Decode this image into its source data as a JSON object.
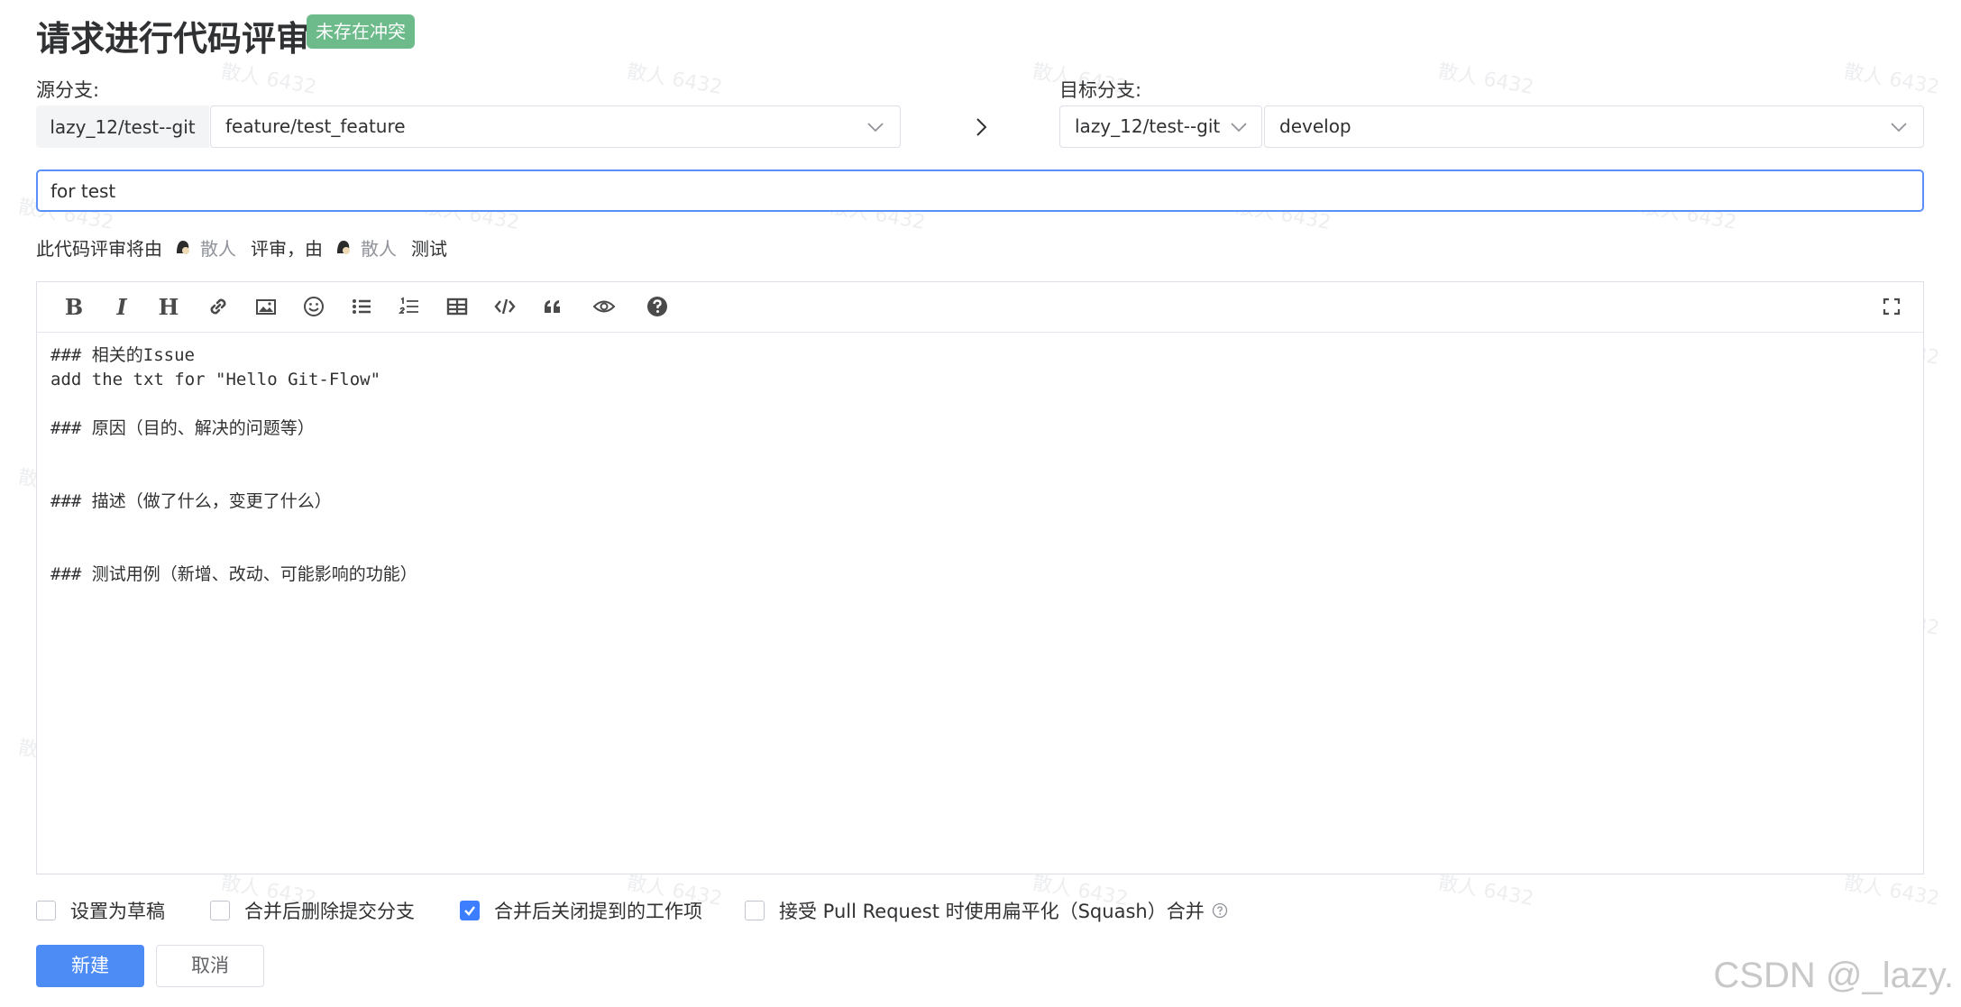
{
  "header": {
    "title": "请求进行代码评审",
    "badge": "未存在冲突"
  },
  "source": {
    "label": "源分支:",
    "repo": "lazy_12/test--git",
    "branch": "feature/test_feature"
  },
  "target": {
    "label": "目标分支:",
    "repo": "lazy_12/test--git",
    "branch": "develop"
  },
  "pr_title": {
    "value": "for test"
  },
  "reviewers": {
    "prefix": "此代码评审将由",
    "reviewer": "散人",
    "middle": "评审，由",
    "tester": "散人",
    "suffix": "测试"
  },
  "toolbar": {
    "items": [
      "bold-icon",
      "italic-icon",
      "heading-icon",
      "link-icon",
      "image-icon",
      "emoji-icon",
      "bullet-list-icon",
      "ordered-list-icon",
      "table-icon",
      "code-icon",
      "quote-icon",
      "preview-icon",
      "help-icon"
    ],
    "fullscreen": "fullscreen-icon"
  },
  "editor": {
    "lines": [
      "### 相关的Issue",
      "add the txt for \"Hello Git-Flow\"",
      "",
      "### 原因（目的、解决的问题等）",
      "",
      "",
      "### 描述（做了什么，变更了什么）",
      "",
      "",
      "### 测试用例（新增、改动、可能影响的功能）"
    ]
  },
  "options": {
    "draft": {
      "label": "设置为草稿",
      "checked": false
    },
    "delete_branch": {
      "label": "合并后删除提交分支",
      "checked": false
    },
    "close_items": {
      "label": "合并后关闭提到的工作项",
      "checked": true
    },
    "squash": {
      "label": "接受 Pull Request 时使用扁平化（Squash）合并",
      "checked": false
    }
  },
  "buttons": {
    "create": "新建",
    "cancel": "取消"
  },
  "watermark": {
    "text": "散人 6432"
  },
  "corner_watermark": "CSDN @_lazy."
}
